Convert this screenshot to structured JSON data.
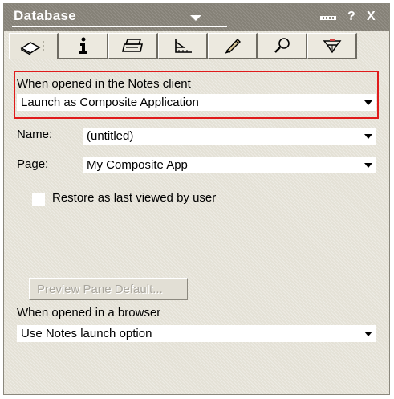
{
  "window": {
    "title": "Database",
    "help_label": "?",
    "close_label": "X"
  },
  "tabs": [
    {
      "icon": "info-tab-icon",
      "active": true
    },
    {
      "icon": "information-i-icon",
      "active": false
    },
    {
      "icon": "printer-icon",
      "active": false
    },
    {
      "icon": "design-ruler-icon",
      "active": false
    },
    {
      "icon": "launch-rocket-icon",
      "active": false
    },
    {
      "icon": "search-magnifier-icon",
      "active": false
    },
    {
      "icon": "advanced-propeller-icon",
      "active": false
    }
  ],
  "notes_client": {
    "label": "When opened in the Notes client",
    "value": "Launch as Composite Application"
  },
  "name": {
    "label": "Name:",
    "value": "(untitled)"
  },
  "page": {
    "label": "Page:",
    "value": "My Composite App"
  },
  "restore": {
    "label": "Restore as last viewed by user",
    "checked": false
  },
  "preview_button": {
    "label": "Preview Pane Default..."
  },
  "browser": {
    "label": "When opened in a browser",
    "value": "Use Notes launch option"
  },
  "colors": {
    "highlight": "#e01b1b",
    "titlebar": "#858177",
    "panel": "#e4e1d6"
  }
}
